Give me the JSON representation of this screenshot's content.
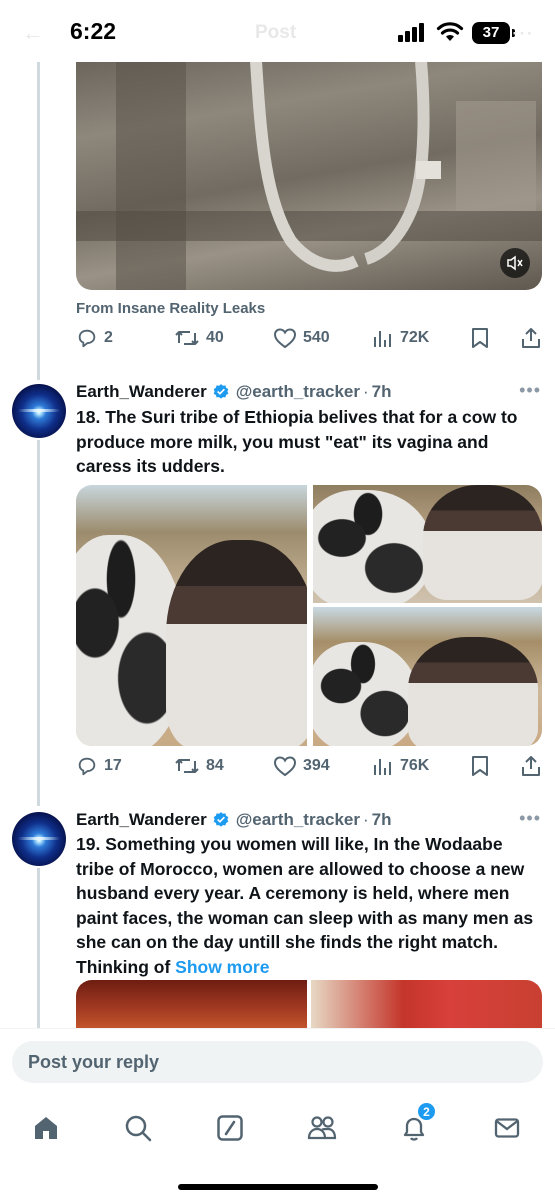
{
  "status_bar": {
    "time": "6:22",
    "battery": "37",
    "ghost_title": "Post"
  },
  "top_tweet": {
    "source": "From Insane Reality Leaks",
    "actions": {
      "replies": "2",
      "reposts": "40",
      "likes": "540",
      "views": "72K"
    }
  },
  "tweets": [
    {
      "name": "Earth_Wanderer",
      "handle": "@earth_tracker",
      "dot": "·",
      "time": "7h",
      "text": "18. The Suri tribe of Ethiopia belives that for a cow to produce more milk, you must \"eat\" its vagina and caress its udders.",
      "actions": {
        "replies": "17",
        "reposts": "84",
        "likes": "394",
        "views": "76K"
      }
    },
    {
      "name": "Earth_Wanderer",
      "handle": "@earth_tracker",
      "dot": "·",
      "time": "7h",
      "text": "19. Something you women will like, In the Wodaabe tribe of Morocco, women are allowed to choose a new husband every year. A ceremony is held, where men paint faces, the woman can sleep with as many men as she can on the day untill she finds the right match. Thinking of ",
      "show_more": "Show more"
    }
  ],
  "reply": {
    "placeholder": "Post your reply"
  },
  "nav": {
    "notifications_badge": "2"
  },
  "colors": {
    "accent": "#1d9bf0",
    "muted": "#536471",
    "text": "#0f1419",
    "line": "#cfd9de"
  }
}
